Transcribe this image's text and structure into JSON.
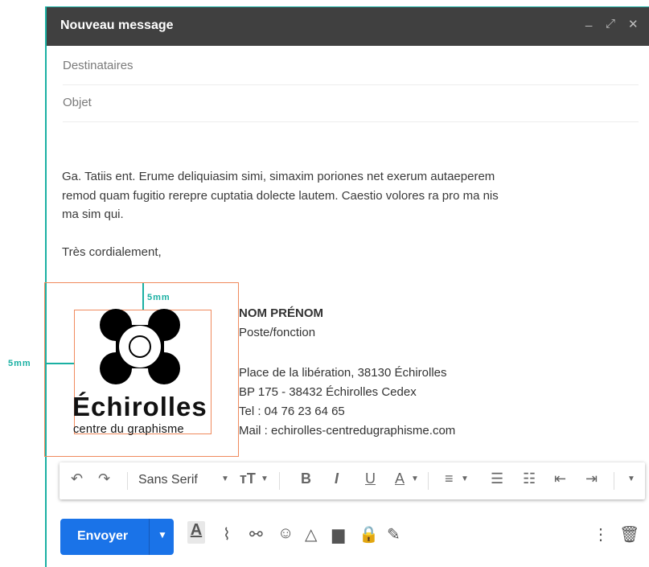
{
  "window": {
    "title": "Nouveau message",
    "controls": [
      "_",
      "⤢",
      "✕"
    ]
  },
  "fields": {
    "recipients_placeholder": "Destinataires",
    "subject_placeholder": "Objet"
  },
  "body": {
    "line1": "Ga. Tatiis ent. Erume deliquiasim simi, simaxim poriones net exerum autaeperem",
    "line2": "remod quam fugitio rerepre cuptatia dolecte lautem. Caestio volores ra pro ma nis",
    "line3": "ma sim qui.",
    "closing": "Très cordialement,"
  },
  "annotations": {
    "top_margin": "5mm",
    "left_margin": "5mm"
  },
  "logo": {
    "name": "Échirolles",
    "tagline": "centre du graphisme"
  },
  "signature": {
    "name": "NOM PRÉNOM",
    "position": "Poste/fonction",
    "address1": "Place de la libération, 38130 Échirolles",
    "address2": "BP 175 - 38432 Échirolles Cedex",
    "phone": "Tel : 04 76 23 64 65",
    "mail": "Mail : echirolles-centredugraphisme.com"
  },
  "toolbar": {
    "font": "Sans Serif",
    "bold": "B",
    "italic": "I",
    "underline": "U",
    "text_color": "A"
  },
  "actions": {
    "send_label": "Envoyer"
  },
  "colors": {
    "accent": "#1ab0a3",
    "guide": "#f08a5d",
    "send": "#1a73e8",
    "titlebar": "#404040"
  }
}
